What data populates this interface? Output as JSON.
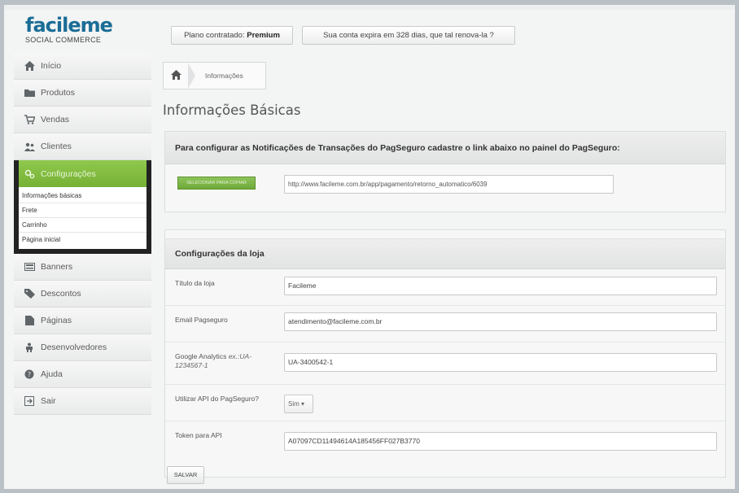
{
  "logo": {
    "brand": "facileme",
    "tagline": "SOCIAL COMMERCE"
  },
  "header": {
    "plan_label": "Plano contratado:",
    "plan_value": "Premium",
    "expire_text": "Sua conta expira em 328 dias, que tal renova-la ?"
  },
  "sidebar": {
    "items": [
      {
        "label": "Início",
        "icon": "home-icon"
      },
      {
        "label": "Produtos",
        "icon": "folder-icon"
      },
      {
        "label": "Vendas",
        "icon": "cart-icon"
      },
      {
        "label": "Clientes",
        "icon": "users-icon"
      },
      {
        "label": "Configurações",
        "icon": "gear-icon"
      },
      {
        "label": "Banners",
        "icon": "banner-icon"
      },
      {
        "label": "Descontos",
        "icon": "tag-icon"
      },
      {
        "label": "Páginas",
        "icon": "page-icon"
      },
      {
        "label": "Desenvolvedores",
        "icon": "developer-icon"
      },
      {
        "label": "Ajuda",
        "icon": "help-icon"
      },
      {
        "label": "Sair",
        "icon": "exit-icon"
      }
    ],
    "subitems": [
      "Informações básicas",
      "Frete",
      "Carrinho",
      "Página inicial"
    ]
  },
  "breadcrumb": {
    "current": "Informações"
  },
  "page_title": "Informações Básicas",
  "notifications": {
    "heading": "Para configurar as Notificações de Transações do PagSeguro cadastre o link abaixo no painel do PagSeguro:",
    "copy_button": "SELECIONAR PARA COPIAR",
    "url": "http://www.facileme.com.br/app/pagamento/retorno_automatico/6039"
  },
  "store_config": {
    "heading": "Configurações da loja",
    "fields": [
      {
        "label": "Título da loja",
        "value": "Facileme"
      },
      {
        "label": "Email Pagseguro",
        "value": "atendimento@facileme.com.br"
      },
      {
        "label": "Google Analytics",
        "hint": "ex.:UA-1234567-1",
        "value": "UA-3400542-1"
      },
      {
        "label": "Utilizar API do PagSeguro?",
        "value": "Sim ▾"
      },
      {
        "label": "Token para API",
        "value": "A07097CD11494614A185456FF027B3770"
      }
    ],
    "save_label": "SALVAR"
  },
  "colors": {
    "brand": "#1a6d96",
    "accent_green": "#7fb93e",
    "sidebar_border": "#222222"
  }
}
